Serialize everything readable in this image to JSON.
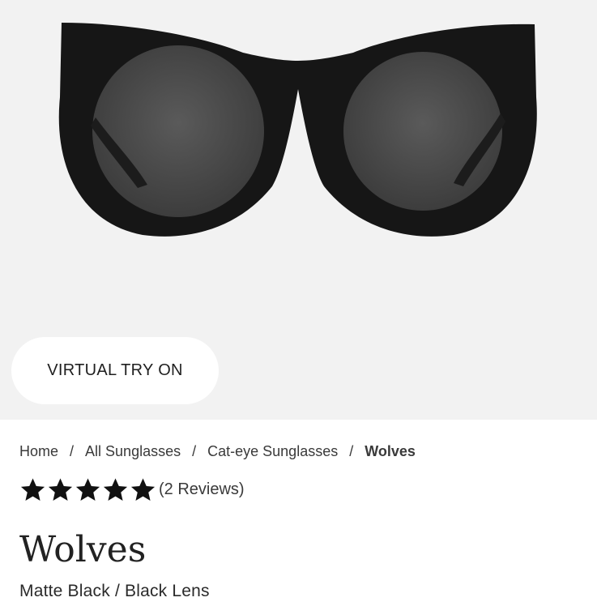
{
  "hero": {
    "background_color": "#f2f2f2",
    "frame_color": "#161616",
    "lens_color": "#3f3f3f",
    "virtual_try_on_label": "VIRTUAL TRY ON"
  },
  "breadcrumb": {
    "items": [
      "Home",
      "All Sunglasses",
      "Cat-eye Sunglasses"
    ],
    "current": "Wolves",
    "separator": "/"
  },
  "rating": {
    "stars": 5,
    "max_stars": 5,
    "star_icon": "star-icon",
    "reviews_label": "(2 Reviews)"
  },
  "product": {
    "name": "Wolves",
    "variant": "Matte Black / Black Lens"
  }
}
